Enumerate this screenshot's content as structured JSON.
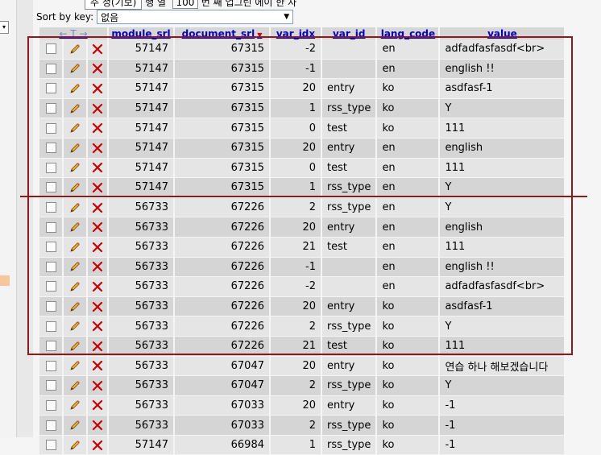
{
  "sort": {
    "label": "Sort by key:",
    "selected": "없음"
  },
  "top": {
    "select_text": "주 정(기보)",
    "text1": "행 열",
    "num_value": "100",
    "text2": "번 째 업그린 에이 한 자"
  },
  "columns": {
    "module_srl": "module_srl",
    "document_srl": "document_srl",
    "var_idx": "var_idx",
    "var_id": "var_id",
    "lang_code": "lang_code",
    "value": "value"
  },
  "rows": [
    {
      "module_srl": "57147",
      "document_srl": "67315",
      "var_idx": "-2",
      "var_id": "",
      "lang_code": "en",
      "value": "adfadfasfasdf<br>"
    },
    {
      "module_srl": "57147",
      "document_srl": "67315",
      "var_idx": "-1",
      "var_id": "",
      "lang_code": "en",
      "value": "english !!"
    },
    {
      "module_srl": "57147",
      "document_srl": "67315",
      "var_idx": "20",
      "var_id": "entry",
      "lang_code": "ko",
      "value": "asdfasf-1"
    },
    {
      "module_srl": "57147",
      "document_srl": "67315",
      "var_idx": "1",
      "var_id": "rss_type",
      "lang_code": "ko",
      "value": "Y"
    },
    {
      "module_srl": "57147",
      "document_srl": "67315",
      "var_idx": "0",
      "var_id": "test",
      "lang_code": "ko",
      "value": "111"
    },
    {
      "module_srl": "57147",
      "document_srl": "67315",
      "var_idx": "20",
      "var_id": "entry",
      "lang_code": "en",
      "value": "english"
    },
    {
      "module_srl": "57147",
      "document_srl": "67315",
      "var_idx": "0",
      "var_id": "test",
      "lang_code": "en",
      "value": "111"
    },
    {
      "module_srl": "57147",
      "document_srl": "67315",
      "var_idx": "1",
      "var_id": "rss_type",
      "lang_code": "en",
      "value": "Y"
    },
    {
      "module_srl": "56733",
      "document_srl": "67226",
      "var_idx": "2",
      "var_id": "rss_type",
      "lang_code": "en",
      "value": "Y"
    },
    {
      "module_srl": "56733",
      "document_srl": "67226",
      "var_idx": "20",
      "var_id": "entry",
      "lang_code": "en",
      "value": "english"
    },
    {
      "module_srl": "56733",
      "document_srl": "67226",
      "var_idx": "21",
      "var_id": "test",
      "lang_code": "en",
      "value": "111"
    },
    {
      "module_srl": "56733",
      "document_srl": "67226",
      "var_idx": "-1",
      "var_id": "",
      "lang_code": "en",
      "value": "english !!"
    },
    {
      "module_srl": "56733",
      "document_srl": "67226",
      "var_idx": "-2",
      "var_id": "",
      "lang_code": "en",
      "value": "adfadfasfasdf<br>"
    },
    {
      "module_srl": "56733",
      "document_srl": "67226",
      "var_idx": "20",
      "var_id": "entry",
      "lang_code": "ko",
      "value": "asdfasf-1"
    },
    {
      "module_srl": "56733",
      "document_srl": "67226",
      "var_idx": "2",
      "var_id": "rss_type",
      "lang_code": "ko",
      "value": "Y"
    },
    {
      "module_srl": "56733",
      "document_srl": "67226",
      "var_idx": "21",
      "var_id": "test",
      "lang_code": "ko",
      "value": "111"
    },
    {
      "module_srl": "56733",
      "document_srl": "67047",
      "var_idx": "20",
      "var_id": "entry",
      "lang_code": "ko",
      "value": "연습 하나 해보겠습니다"
    },
    {
      "module_srl": "56733",
      "document_srl": "67047",
      "var_idx": "2",
      "var_id": "rss_type",
      "lang_code": "ko",
      "value": "Y"
    },
    {
      "module_srl": "56733",
      "document_srl": "67033",
      "var_idx": "20",
      "var_id": "entry",
      "lang_code": "ko",
      "value": "-1"
    },
    {
      "module_srl": "56733",
      "document_srl": "67033",
      "var_idx": "2",
      "var_id": "rss_type",
      "lang_code": "ko",
      "value": "-1"
    },
    {
      "module_srl": "57147",
      "document_srl": "66984",
      "var_idx": "1",
      "var_id": "rss_type",
      "lang_code": "ko",
      "value": "-1"
    }
  ],
  "colors": {
    "highlight": "#8b1a1a",
    "header_link": "#0000cc",
    "row_light": "#e5e5e5",
    "row_dark": "#d5d5d5",
    "delete_x": "#cc0000"
  },
  "icons": {
    "edit": "pencil-icon",
    "delete": "delete-x-icon",
    "sort_desc": "sort-desc-arrow-icon"
  }
}
